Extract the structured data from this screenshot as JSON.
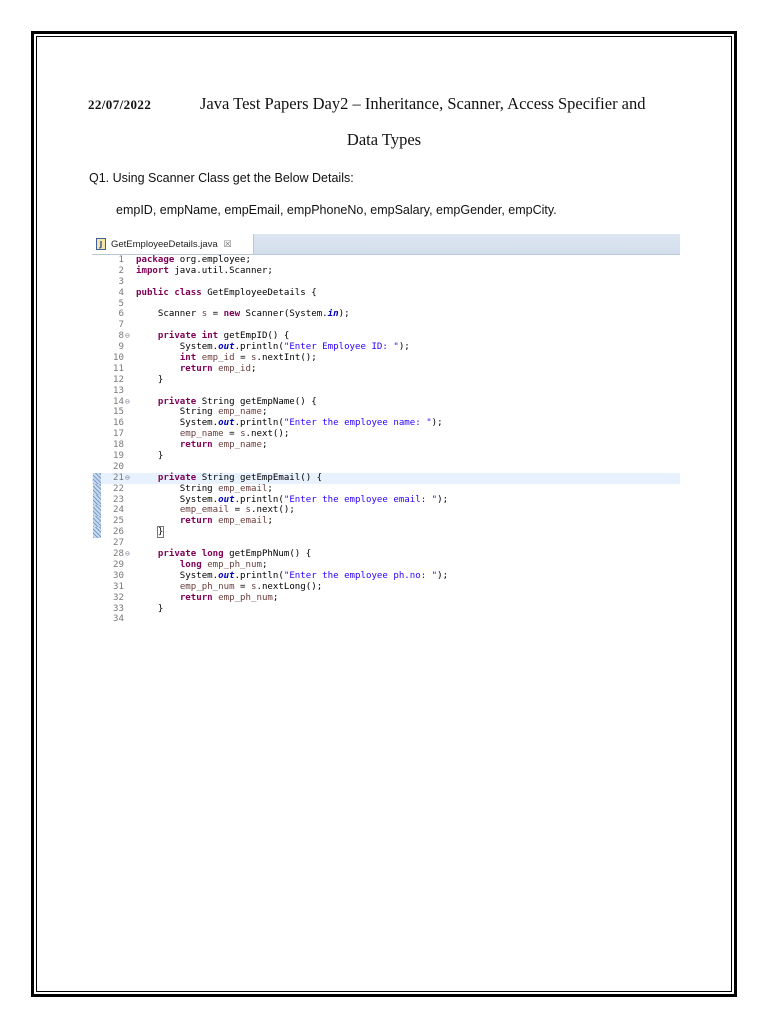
{
  "header": {
    "date": "22/07/2022",
    "title_line1": "Java Test Papers Day2 – Inheritance, Scanner, Access Specifier and",
    "title_line2": "Data Types"
  },
  "question": {
    "text": "Q1. Using Scanner Class get the Below Details:",
    "fields": "empID, empName, empEmail, empPhoneNo, empSalary, empGender, empCity."
  },
  "editor": {
    "tab_label": "GetEmployeeDetails.java",
    "tab_close": "☒",
    "file_icon": "J",
    "current_line": 21,
    "lines": [
      {
        "n": "1",
        "tokens": [
          {
            "t": "package",
            "c": "kw"
          },
          {
            "t": " org.employee;"
          }
        ]
      },
      {
        "n": "2",
        "tokens": [
          {
            "t": "import",
            "c": "kw"
          },
          {
            "t": " java.util.Scanner;"
          }
        ]
      },
      {
        "n": "3",
        "tokens": []
      },
      {
        "n": "4",
        "tokens": [
          {
            "t": "public",
            "c": "kw"
          },
          {
            "t": " "
          },
          {
            "t": "class",
            "c": "kw"
          },
          {
            "t": " GetEmployeeDetails {"
          }
        ]
      },
      {
        "n": "5",
        "tokens": []
      },
      {
        "n": "6",
        "tokens": [
          {
            "t": "    Scanner "
          },
          {
            "t": "s",
            "c": "var"
          },
          {
            "t": " = "
          },
          {
            "t": "new",
            "c": "kw"
          },
          {
            "t": " Scanner(System."
          },
          {
            "t": "in",
            "c": "fld"
          },
          {
            "t": ");"
          }
        ]
      },
      {
        "n": "7",
        "tokens": []
      },
      {
        "n": "8",
        "fold": "⊖",
        "tokens": [
          {
            "t": "    "
          },
          {
            "t": "private",
            "c": "kw"
          },
          {
            "t": " "
          },
          {
            "t": "int",
            "c": "kw"
          },
          {
            "t": " getEmpID() {"
          }
        ]
      },
      {
        "n": "9",
        "tokens": [
          {
            "t": "        System."
          },
          {
            "t": "out",
            "c": "fld"
          },
          {
            "t": ".println("
          },
          {
            "t": "\"Enter Employee ID: \"",
            "c": "str"
          },
          {
            "t": ");"
          }
        ]
      },
      {
        "n": "10",
        "tokens": [
          {
            "t": "        "
          },
          {
            "t": "int",
            "c": "kw"
          },
          {
            "t": " "
          },
          {
            "t": "emp_id",
            "c": "var"
          },
          {
            "t": " = "
          },
          {
            "t": "s",
            "c": "var"
          },
          {
            "t": ".nextInt();"
          }
        ]
      },
      {
        "n": "11",
        "tokens": [
          {
            "t": "        "
          },
          {
            "t": "return",
            "c": "kw"
          },
          {
            "t": " "
          },
          {
            "t": "emp_id",
            "c": "var"
          },
          {
            "t": ";"
          }
        ]
      },
      {
        "n": "12",
        "tokens": [
          {
            "t": "    }"
          }
        ]
      },
      {
        "n": "13",
        "tokens": []
      },
      {
        "n": "14",
        "fold": "⊖",
        "tokens": [
          {
            "t": "    "
          },
          {
            "t": "private",
            "c": "kw"
          },
          {
            "t": " String getEmpName() {"
          }
        ]
      },
      {
        "n": "15",
        "tokens": [
          {
            "t": "        String "
          },
          {
            "t": "emp_name",
            "c": "var"
          },
          {
            "t": ";"
          }
        ]
      },
      {
        "n": "16",
        "tokens": [
          {
            "t": "        System."
          },
          {
            "t": "out",
            "c": "fld"
          },
          {
            "t": ".println("
          },
          {
            "t": "\"Enter the employee name: \"",
            "c": "str"
          },
          {
            "t": ");"
          }
        ]
      },
      {
        "n": "17",
        "tokens": [
          {
            "t": "        "
          },
          {
            "t": "emp_name",
            "c": "var"
          },
          {
            "t": " = "
          },
          {
            "t": "s",
            "c": "var"
          },
          {
            "t": ".next();"
          }
        ]
      },
      {
        "n": "18",
        "tokens": [
          {
            "t": "        "
          },
          {
            "t": "return",
            "c": "kw"
          },
          {
            "t": " "
          },
          {
            "t": "emp_name",
            "c": "var"
          },
          {
            "t": ";"
          }
        ]
      },
      {
        "n": "19",
        "tokens": [
          {
            "t": "    }"
          }
        ]
      },
      {
        "n": "20",
        "tokens": []
      },
      {
        "n": "21",
        "fold": "⊖",
        "tokens": [
          {
            "t": "    "
          },
          {
            "t": "private",
            "c": "kw"
          },
          {
            "t": " String getEmpEmail() {"
          }
        ]
      },
      {
        "n": "22",
        "tokens": [
          {
            "t": "        String "
          },
          {
            "t": "emp_email",
            "c": "var"
          },
          {
            "t": ";"
          }
        ]
      },
      {
        "n": "23",
        "tokens": [
          {
            "t": "        System."
          },
          {
            "t": "out",
            "c": "fld"
          },
          {
            "t": ".println("
          },
          {
            "t": "\"Enter the employee email: \"",
            "c": "str"
          },
          {
            "t": ");"
          }
        ]
      },
      {
        "n": "24",
        "tokens": [
          {
            "t": "        "
          },
          {
            "t": "emp_email",
            "c": "var"
          },
          {
            "t": " = "
          },
          {
            "t": "s",
            "c": "var"
          },
          {
            "t": ".next();"
          }
        ]
      },
      {
        "n": "25",
        "tokens": [
          {
            "t": "        "
          },
          {
            "t": "return",
            "c": "kw"
          },
          {
            "t": " "
          },
          {
            "t": "emp_email",
            "c": "var"
          },
          {
            "t": ";"
          }
        ]
      },
      {
        "n": "26",
        "tokens": [
          {
            "t": "    "
          },
          {
            "t": "}",
            "c": "caret"
          }
        ]
      },
      {
        "n": "27",
        "tokens": []
      },
      {
        "n": "28",
        "fold": "⊖",
        "tokens": [
          {
            "t": "    "
          },
          {
            "t": "private",
            "c": "kw"
          },
          {
            "t": " "
          },
          {
            "t": "long",
            "c": "kw"
          },
          {
            "t": " getEmpPhNum() {"
          }
        ]
      },
      {
        "n": "29",
        "tokens": [
          {
            "t": "        "
          },
          {
            "t": "long",
            "c": "kw"
          },
          {
            "t": " "
          },
          {
            "t": "emp_ph_num",
            "c": "var"
          },
          {
            "t": ";"
          }
        ]
      },
      {
        "n": "30",
        "tokens": [
          {
            "t": "        System."
          },
          {
            "t": "out",
            "c": "fld"
          },
          {
            "t": ".println("
          },
          {
            "t": "\"Enter the employee ph.no: \"",
            "c": "str"
          },
          {
            "t": ");"
          }
        ]
      },
      {
        "n": "31",
        "tokens": [
          {
            "t": "        "
          },
          {
            "t": "emp_ph_num",
            "c": "var"
          },
          {
            "t": " = "
          },
          {
            "t": "s",
            "c": "var"
          },
          {
            "t": ".nextLong();"
          }
        ]
      },
      {
        "n": "32",
        "tokens": [
          {
            "t": "        "
          },
          {
            "t": "return",
            "c": "kw"
          },
          {
            "t": " "
          },
          {
            "t": "emp_ph_num",
            "c": "var"
          },
          {
            "t": ";"
          }
        ]
      },
      {
        "n": "33",
        "tokens": [
          {
            "t": "    }"
          }
        ]
      },
      {
        "n": "34",
        "tokens": []
      }
    ]
  }
}
